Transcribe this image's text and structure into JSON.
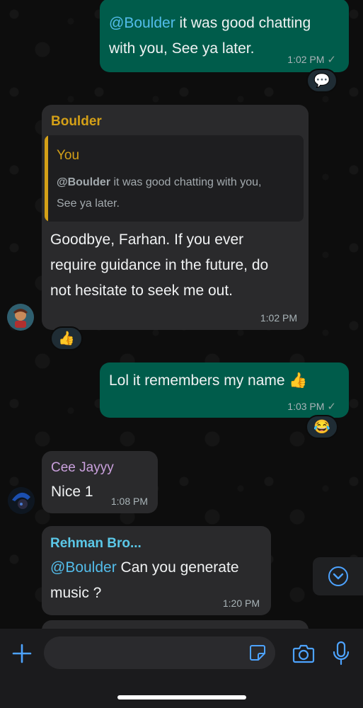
{
  "messages": {
    "m1": {
      "mention": "@Boulder",
      "text_line1": " it was good chatting",
      "text_line2": "with you, See ya later.",
      "time": "1:02 PM",
      "reaction": "💬"
    },
    "m2": {
      "sender": "Boulder",
      "quote_sender": "You",
      "quote_mention": "@Boulder",
      "quote_line1": " it was good chatting with you,",
      "quote_line2": "See ya later.",
      "line1": "Goodbye, Farhan. If you ever",
      "line2": "require guidance in the future, do",
      "line3": "not hesitate to seek me out.",
      "time": "1:02 PM",
      "reaction": "👍"
    },
    "m3": {
      "text": "Lol it remembers my name 👍",
      "time": "1:03 PM",
      "reaction": "😂"
    },
    "m4": {
      "sender": "Cee Jayyy",
      "text": "Nice 1",
      "time": "1:08 PM"
    },
    "m5": {
      "sender": "Rehman Bro...",
      "mention": "@Boulder",
      "line1_rest": " Can you generate",
      "line2": "music ?",
      "time": "1:20 PM"
    }
  },
  "colors": {
    "outgoing": "#005c4b",
    "incoming": "#2a2a2c",
    "boulder_name": "#d4a017",
    "quote_bar": "#d4a017",
    "cee_name": "#c9a0dc",
    "rehman_name": "#5bc8e8",
    "accent": "#4da3ff"
  },
  "composer": {
    "placeholder": ""
  }
}
